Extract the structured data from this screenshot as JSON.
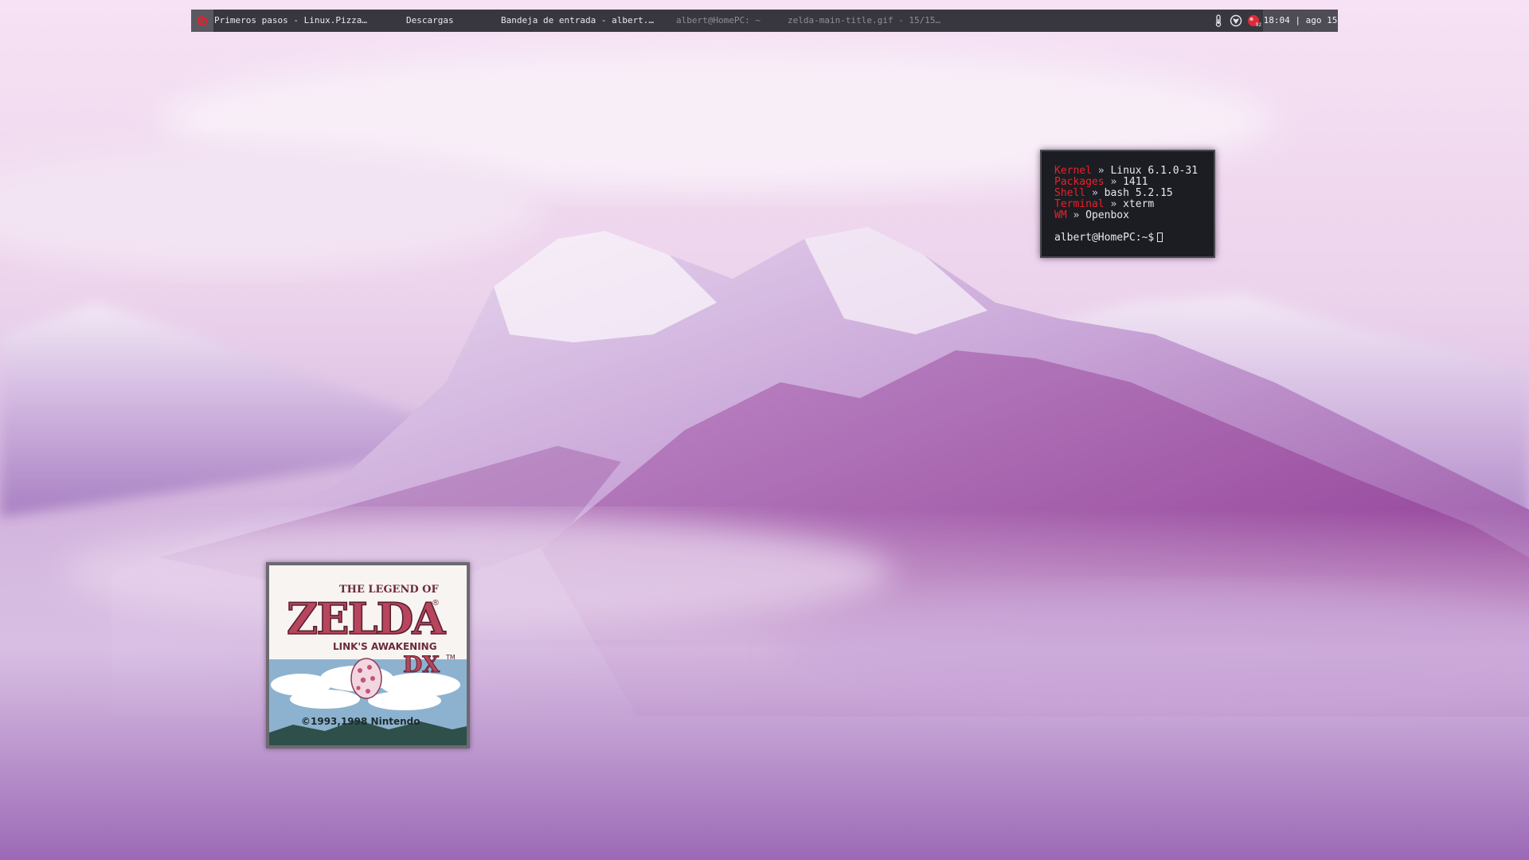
{
  "panel": {
    "tasks": [
      {
        "label": "Primeros pasos - Linux.Pizza…",
        "active": true
      },
      {
        "label": "Descargas",
        "active": true
      },
      {
        "label": "Bandeja de entrada - albert.…",
        "active": true
      },
      {
        "label": "albert@HomePC: ~",
        "active": false
      },
      {
        "label": "zelda-main-title.gif - 15/15…",
        "active": false
      }
    ],
    "tray": {
      "icons": [
        "thermometer-icon",
        "shield-icon",
        "notification-badge-icon"
      ],
      "badge_count": "92"
    },
    "clock": "18:04 | ago 15",
    "colors": {
      "panel_bg": "#383740",
      "accent": "#e8202c"
    }
  },
  "terminal": {
    "info": [
      {
        "key": "Kernel",
        "sep": "»",
        "value": "Linux 6.1.0-31"
      },
      {
        "key": "Packages",
        "sep": "»",
        "value": "1411"
      },
      {
        "key": "Shell",
        "sep": "»",
        "value": "bash 5.2.15"
      },
      {
        "key": "Terminal",
        "sep": "»",
        "value": "xterm"
      },
      {
        "key": "WM",
        "sep": "»",
        "value": "Openbox"
      }
    ],
    "prompt": "albert@HomePC:~$"
  },
  "viewer": {
    "title_line1": "THE LEGEND OF",
    "title_main": "ZELDA",
    "subtitle": "LINK'S AWAKENING",
    "edition": "DX",
    "trademark": "TM",
    "copyright": "©1993,1998 Nintendo"
  }
}
